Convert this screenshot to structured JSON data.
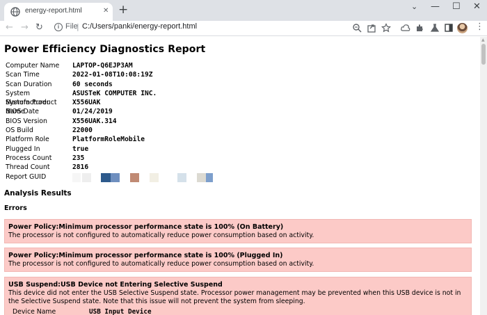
{
  "browser": {
    "tab_title": "energy-report.html",
    "scheme_label": "File",
    "url": "C:/Users/panki/energy-report.html"
  },
  "report": {
    "title": "Power Efficiency Diagnostics Report",
    "info": [
      {
        "key": "Computer Name",
        "value": "LAPTOP-Q6EJP3AM"
      },
      {
        "key": "Scan Time",
        "value": "2022-01-08T10:08:19Z"
      },
      {
        "key": "Scan Duration",
        "value": "60 seconds"
      },
      {
        "key": "System Manufacturer",
        "value": "ASUSTeK COMPUTER INC."
      },
      {
        "key": "System Product Name",
        "value": "X556UAK"
      },
      {
        "key": "BIOS Date",
        "value": "01/24/2019"
      },
      {
        "key": "BIOS Version",
        "value": "X556UAK.314"
      },
      {
        "key": "OS Build",
        "value": "22000"
      },
      {
        "key": "Platform Role",
        "value": "PlatformRoleMobile"
      },
      {
        "key": "Plugged In",
        "value": "true"
      },
      {
        "key": "Process Count",
        "value": "235"
      },
      {
        "key": "Thread Count",
        "value": "2816"
      },
      {
        "key": "Report GUID",
        "value": ""
      }
    ],
    "guid_redaction_colors": [
      "#f6f6f6",
      "#eeeeee",
      "#2d5a8c",
      "#6f8fbf",
      "#c08a74",
      "#f2efe4",
      "#d5e1ea",
      "#dcdad2",
      "#7d9fcc"
    ],
    "analysis_heading": "Analysis Results",
    "errors_heading": "Errors",
    "errors": [
      {
        "title": "Power Policy:Minimum processor performance state is 100% (On Battery)",
        "description": "The processor is not configured to automatically reduce power consumption based on activity."
      },
      {
        "title": "Power Policy:Minimum processor performance state is 100% (Plugged In)",
        "description": "The processor is not configured to automatically reduce power consumption based on activity."
      },
      {
        "title": "USB Suspend:USB Device not Entering Selective Suspend",
        "description": "This device did not enter the USB Selective Suspend state. Processor power management may be prevented when this USB device is not in the Selective Suspend state. Note that this issue will not prevent the system from sleeping.",
        "detail_key": "Device Name",
        "detail_value": "USB Input Device"
      }
    ]
  },
  "colors": {
    "error_background": "#fccac7",
    "tabstrip": "#dee1e6"
  }
}
